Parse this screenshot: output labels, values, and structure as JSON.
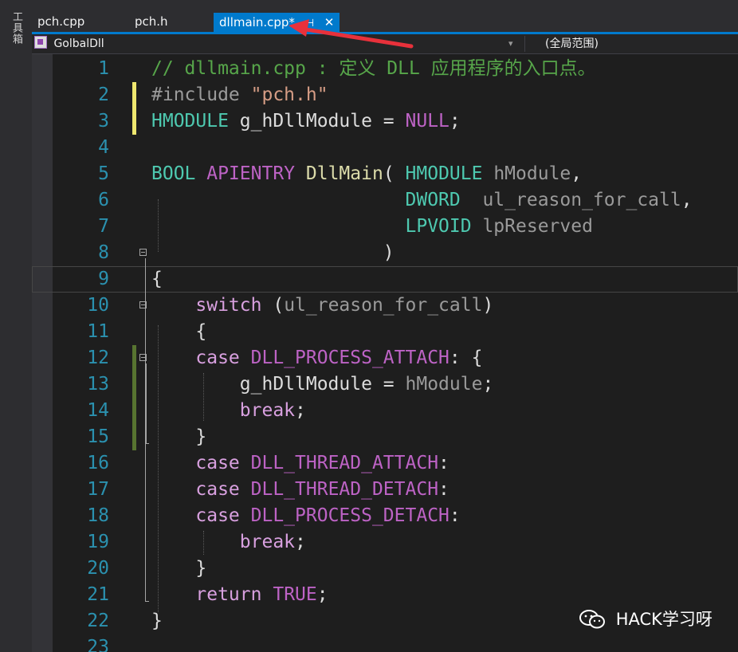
{
  "toolbox_label": "工具箱",
  "tabs": [
    {
      "label": "pch.cpp",
      "active": false
    },
    {
      "label": "pch.h",
      "active": false
    },
    {
      "label": "dllmain.cpp*",
      "active": true
    }
  ],
  "tab_pin_glyph": "⊣",
  "tab_close_glyph": "✕",
  "navbar": {
    "scope_left": "GolbalDll",
    "scope_right": "(全局范围)"
  },
  "code_lines": [
    {
      "n": "1",
      "tokens": [
        [
          "c-com",
          "// dllmain.cpp : 定义 DLL 应用程序的入口点。"
        ]
      ]
    },
    {
      "n": "2",
      "tokens": [
        [
          "c-pp",
          "#include "
        ],
        [
          "c-str",
          "\"pch.h\""
        ]
      ]
    },
    {
      "n": "3",
      "tokens": [
        [
          "c-type",
          "HMODULE"
        ],
        [
          "c-def",
          " g_hDllModule = "
        ],
        [
          "c-mac",
          "NULL"
        ],
        [
          "c-def",
          ";"
        ]
      ]
    },
    {
      "n": "4",
      "tokens": []
    },
    {
      "n": "5",
      "tokens": [
        [
          "c-type",
          "BOOL"
        ],
        [
          "c-def",
          " "
        ],
        [
          "c-mac",
          "APIENTRY"
        ],
        [
          "c-def",
          " "
        ],
        [
          "c-fn",
          "DllMain"
        ],
        [
          "c-def",
          "( "
        ],
        [
          "c-type",
          "HMODULE"
        ],
        [
          "c-def",
          " "
        ],
        [
          "c-par",
          "hModule"
        ],
        [
          "c-def",
          ","
        ]
      ]
    },
    {
      "n": "6",
      "tokens": [
        [
          "c-def",
          "                       "
        ],
        [
          "c-type",
          "DWORD"
        ],
        [
          "c-def",
          "  "
        ],
        [
          "c-par",
          "ul_reason_for_call"
        ],
        [
          "c-def",
          ","
        ]
      ]
    },
    {
      "n": "7",
      "tokens": [
        [
          "c-def",
          "                       "
        ],
        [
          "c-type",
          "LPVOID"
        ],
        [
          "c-def",
          " "
        ],
        [
          "c-par",
          "lpReserved"
        ]
      ]
    },
    {
      "n": "8",
      "tokens": [
        [
          "c-def",
          "                     )"
        ]
      ]
    },
    {
      "n": "9",
      "tokens": [
        [
          "c-def",
          "{"
        ]
      ]
    },
    {
      "n": "10",
      "tokens": [
        [
          "c-def",
          "    "
        ],
        [
          "c-kw",
          "switch"
        ],
        [
          "c-def",
          " ("
        ],
        [
          "c-par",
          "ul_reason_for_call"
        ],
        [
          "c-def",
          ")"
        ]
      ]
    },
    {
      "n": "11",
      "tokens": [
        [
          "c-def",
          "    {"
        ]
      ]
    },
    {
      "n": "12",
      "tokens": [
        [
          "c-def",
          "    "
        ],
        [
          "c-kw",
          "case"
        ],
        [
          "c-def",
          " "
        ],
        [
          "c-mac",
          "DLL_PROCESS_ATTACH"
        ],
        [
          "c-def",
          ": {"
        ]
      ]
    },
    {
      "n": "13",
      "tokens": [
        [
          "c-def",
          "        g_hDllModule = "
        ],
        [
          "c-par",
          "hModule"
        ],
        [
          "c-def",
          ";"
        ]
      ]
    },
    {
      "n": "14",
      "tokens": [
        [
          "c-def",
          "        "
        ],
        [
          "c-kw",
          "break"
        ],
        [
          "c-def",
          ";"
        ]
      ]
    },
    {
      "n": "15",
      "tokens": [
        [
          "c-def",
          "    }"
        ]
      ]
    },
    {
      "n": "16",
      "tokens": [
        [
          "c-def",
          "    "
        ],
        [
          "c-kw",
          "case"
        ],
        [
          "c-def",
          " "
        ],
        [
          "c-mac",
          "DLL_THREAD_ATTACH"
        ],
        [
          "c-def",
          ":"
        ]
      ]
    },
    {
      "n": "17",
      "tokens": [
        [
          "c-def",
          "    "
        ],
        [
          "c-kw",
          "case"
        ],
        [
          "c-def",
          " "
        ],
        [
          "c-mac",
          "DLL_THREAD_DETACH"
        ],
        [
          "c-def",
          ":"
        ]
      ]
    },
    {
      "n": "18",
      "tokens": [
        [
          "c-def",
          "    "
        ],
        [
          "c-kw",
          "case"
        ],
        [
          "c-def",
          " "
        ],
        [
          "c-mac",
          "DLL_PROCESS_DETACH"
        ],
        [
          "c-def",
          ":"
        ]
      ]
    },
    {
      "n": "19",
      "tokens": [
        [
          "c-def",
          "        "
        ],
        [
          "c-kw",
          "break"
        ],
        [
          "c-def",
          ";"
        ]
      ]
    },
    {
      "n": "20",
      "tokens": [
        [
          "c-def",
          "    }"
        ]
      ]
    },
    {
      "n": "21",
      "tokens": [
        [
          "c-def",
          "    "
        ],
        [
          "c-kw",
          "return"
        ],
        [
          "c-def",
          " "
        ],
        [
          "c-mac",
          "TRUE"
        ],
        [
          "c-def",
          ";"
        ]
      ]
    },
    {
      "n": "22",
      "tokens": [
        [
          "c-def",
          "}"
        ]
      ]
    },
    {
      "n": "23",
      "tokens": []
    }
  ],
  "colors": {
    "accent": "#007acc",
    "change_saved": "#577430",
    "change_unsaved": "#efe76f",
    "arrow": "#e8313b"
  },
  "watermark": {
    "text": "HACK学习呀",
    "icon": "wechat-icon"
  }
}
